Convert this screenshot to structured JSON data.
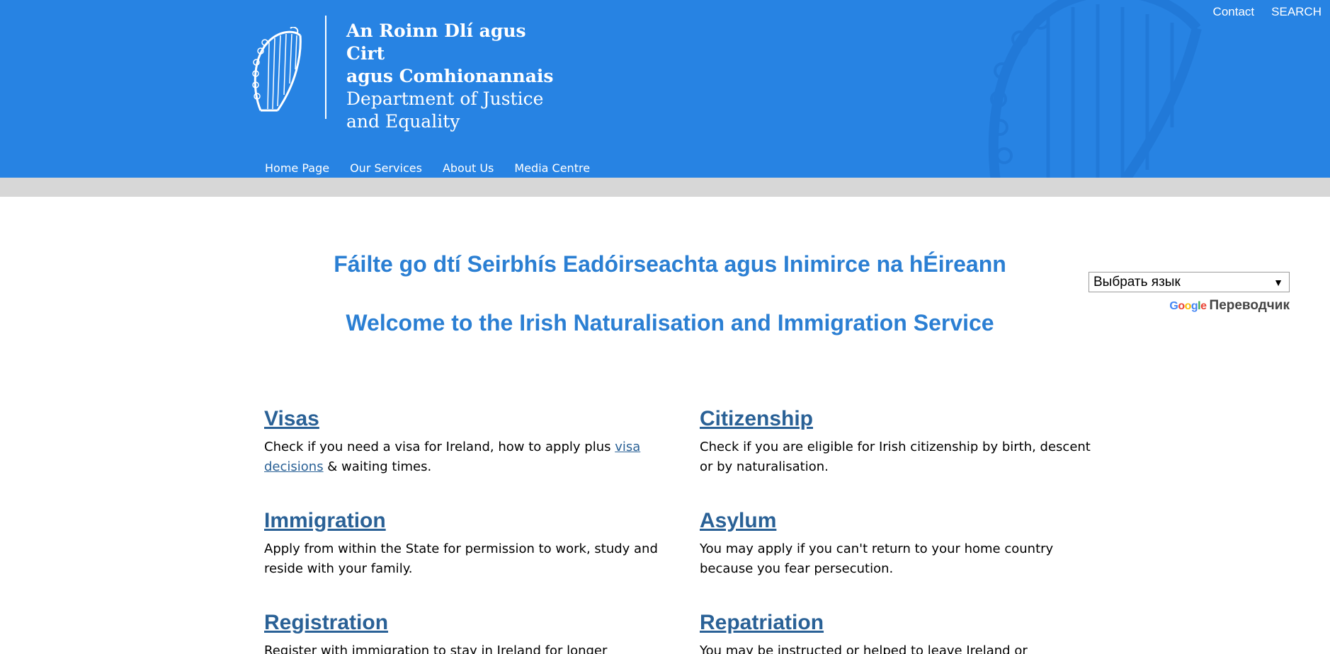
{
  "header": {
    "logo_lines": [
      "An Roinn Dlí agus Cirt",
      "agus Comhionannais",
      "Department of Justice",
      "and Equality"
    ],
    "utility_links": [
      "Contact",
      "SEARCH"
    ],
    "nav": [
      "Home Page",
      "Our Services",
      "About Us",
      "Media Centre"
    ],
    "colors": {
      "banner": "#2783e3",
      "grey_bar": "#d7d7d7"
    }
  },
  "welcome": {
    "irish": "Fáilte go dtí Seirbhís Eadóirseachta agus Inimirce na hÉireann",
    "english": "Welcome to the Irish Naturalisation and Immigration Service",
    "color": "#2b7fd3"
  },
  "translate": {
    "select_value": "Выбрать язык",
    "arrow": "▼",
    "google": "Google",
    "translator": "Переводчик"
  },
  "services": [
    {
      "title": "Visas",
      "text_before": "Check if you need a visa for Ireland, how to apply plus ",
      "link": "visa decisions",
      "text_after": " & waiting times."
    },
    {
      "title": "Citizenship",
      "text": "Check if you are eligible for Irish citizenship by birth, descent or by naturalisation."
    },
    {
      "title": "Immigration",
      "text": "Apply from within the State for permission to work, study and reside with your family."
    },
    {
      "title": "Asylum",
      "text": "You may apply if you can't return to your home country because you fear persecution."
    },
    {
      "title": "Registration",
      "text": "Register with immigration to stay in Ireland for longer"
    },
    {
      "title": "Repatriation",
      "text": "You may be instructed or helped to leave Ireland or"
    }
  ],
  "link_color": "#2a6196"
}
